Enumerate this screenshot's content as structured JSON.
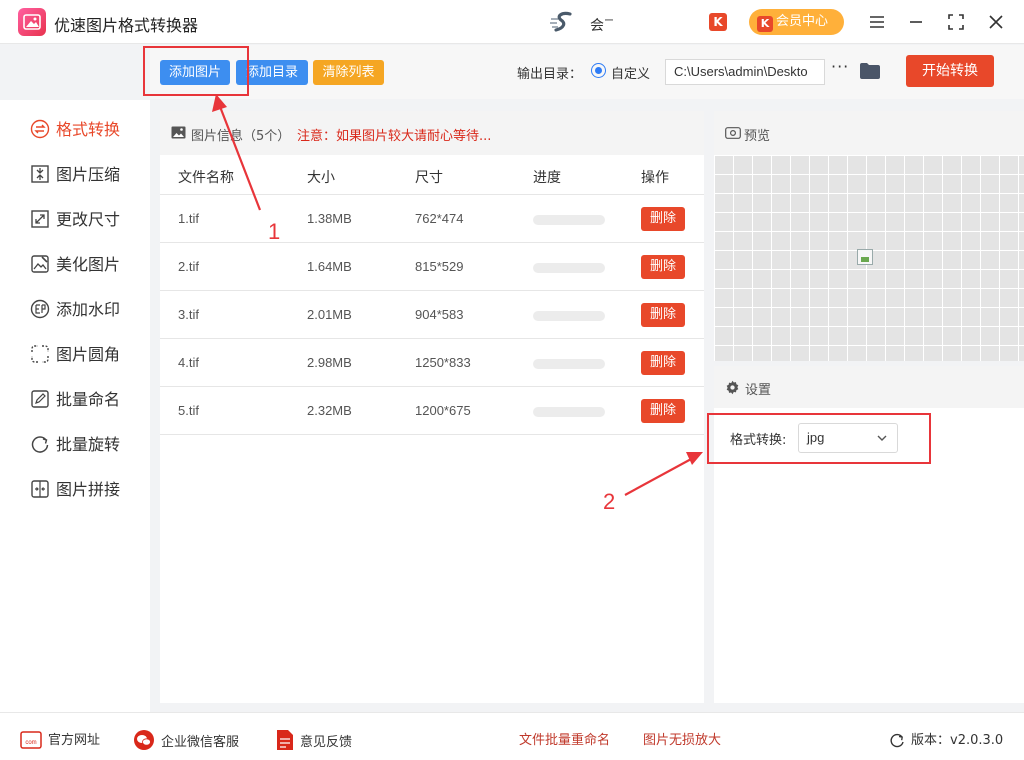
{
  "app": {
    "title": "优速图片格式转换器",
    "user_name": "会"
  },
  "titlebar": {
    "k_badge": "K",
    "vip_label": "会员中心"
  },
  "toolbar": {
    "add_image": "添加图片",
    "add_dir": "添加目录",
    "clear_list": "清除列表",
    "output_label": "输出目录：",
    "radio_label": "自定义",
    "path_value": "C:\\Users\\admin\\Deskto",
    "more": "···",
    "start": "开始转换"
  },
  "sidebar": {
    "items": [
      {
        "label": "格式转换",
        "icon": "convert-icon",
        "active": true
      },
      {
        "label": "图片压缩",
        "icon": "compress-icon"
      },
      {
        "label": "更改尺寸",
        "icon": "resize-icon"
      },
      {
        "label": "美化图片",
        "icon": "beautify-icon"
      },
      {
        "label": "添加水印",
        "icon": "watermark-icon"
      },
      {
        "label": "图片圆角",
        "icon": "round-corner-icon"
      },
      {
        "label": "批量命名",
        "icon": "rename-icon"
      },
      {
        "label": "批量旋转",
        "icon": "rotate-icon"
      },
      {
        "label": "图片拼接",
        "icon": "stitch-icon"
      }
    ]
  },
  "list": {
    "title": "图片信息（5个）",
    "note": "注意：如果图片较大请耐心等待...",
    "columns": [
      "文件名称",
      "大小",
      "尺寸",
      "进度",
      "操作"
    ],
    "delete_label": "删除",
    "rows": [
      {
        "name": "1.tif",
        "size": "1.38MB",
        "dims": "762*474",
        "progress": 0
      },
      {
        "name": "2.tif",
        "size": "1.64MB",
        "dims": "815*529",
        "progress": 0
      },
      {
        "name": "3.tif",
        "size": "2.01MB",
        "dims": "904*583",
        "progress": 0
      },
      {
        "name": "4.tif",
        "size": "2.98MB",
        "dims": "1250*833",
        "progress": 0
      },
      {
        "name": "5.tif",
        "size": "2.32MB",
        "dims": "1200*675",
        "progress": 0
      }
    ]
  },
  "preview": {
    "label": "预览"
  },
  "settings": {
    "label": "设置",
    "format_label": "格式转换:",
    "format_value": "jpg"
  },
  "annotations": {
    "one": "1",
    "two": "2"
  },
  "footer": {
    "website": "官方网址",
    "wechat": "企业微信客服",
    "feedback": "意见反馈",
    "link1": "文件批量重命名",
    "link2": "图片无损放大",
    "version": "版本：v2.0.3.0"
  },
  "colors": {
    "accent_red": "#e8482a",
    "accent_blue": "#3d8ef0",
    "accent_orange": "#f5a623",
    "annotation_red": "#e8353a"
  }
}
